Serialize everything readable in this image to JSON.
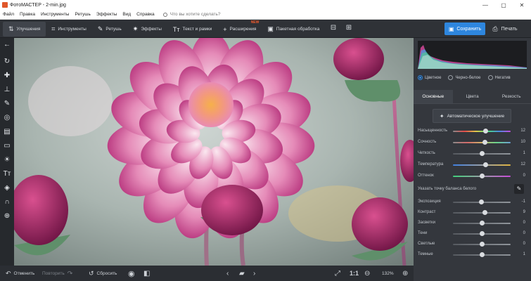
{
  "window": {
    "title": "ФотоМАСТЕР - 2-min.jpg",
    "controls": [
      "—",
      "▢",
      "✕"
    ]
  },
  "menu": {
    "items": [
      "Файл",
      "Правка",
      "Инструменты",
      "Ретушь",
      "Эффекты",
      "Вид",
      "Справка"
    ],
    "search_placeholder": "Что вы хотите сделать?"
  },
  "toolbar": {
    "tabs": [
      {
        "label": "Улучшения",
        "icon": "enhance-icon",
        "active": true
      },
      {
        "label": "Инструменты",
        "icon": "crop-icon",
        "active": false
      },
      {
        "label": "Ретушь",
        "icon": "brush-icon",
        "active": false
      },
      {
        "label": "Эффекты",
        "icon": "sparkle-icon",
        "active": false
      },
      {
        "label": "Текст и рамки",
        "icon": "text-icon",
        "active": false
      },
      {
        "label": "Расширения",
        "icon": "plus-icon",
        "active": false,
        "badge": "NEW"
      },
      {
        "label": "Пакетная обработка",
        "icon": "batch-icon",
        "active": false
      }
    ],
    "save_label": "Сохранить",
    "print_label": "Печать"
  },
  "histogram": {
    "modes": [
      "Цветное",
      "Черно-белое",
      "Негатив"
    ],
    "selected_mode": "Цветное"
  },
  "panel": {
    "tabs": [
      "Основные",
      "Цвета",
      "Резкость"
    ],
    "active_tab": "Основные",
    "auto_enhance_label": "Автоматическое улучшение",
    "white_balance_label": "Указать точку баланса белого",
    "sliders": [
      {
        "label": "Насыщенность",
        "value": "12",
        "fraction": 0.57,
        "gradient": "sat"
      },
      {
        "label": "Сочность",
        "value": "10",
        "fraction": 0.56,
        "gradient": "vib"
      },
      {
        "label": "Четкость",
        "value": "1",
        "fraction": 0.51,
        "gradient": "gray"
      },
      {
        "label": "Температура",
        "value": "12",
        "fraction": 0.57,
        "gradient": "temp"
      },
      {
        "label": "Оттенок",
        "value": "0",
        "fraction": 0.5,
        "gradient": "tint"
      },
      {
        "label": "Экспозиция",
        "value": "-1",
        "fraction": 0.49,
        "gradient": "gray"
      },
      {
        "label": "Контраст",
        "value": "9",
        "fraction": 0.55,
        "gradient": "gray"
      },
      {
        "label": "Засветки",
        "value": "0",
        "fraction": 0.5,
        "gradient": "gray"
      },
      {
        "label": "Тени",
        "value": "0",
        "fraction": 0.5,
        "gradient": "gray"
      },
      {
        "label": "Светлые",
        "value": "0",
        "fraction": 0.5,
        "gradient": "gray"
      },
      {
        "label": "Темные",
        "value": "1",
        "fraction": 0.51,
        "gradient": "gray"
      }
    ]
  },
  "bottombar": {
    "undo_label": "Отменить",
    "redo_label": "Повторить",
    "reset_label": "Сбросить",
    "fit_label": "1:1",
    "zoom_label": "132%"
  },
  "colors": {
    "accent": "#2e86de",
    "new_badge": "#f0592b",
    "background": "#2b2e33",
    "panel": "#34373d"
  }
}
